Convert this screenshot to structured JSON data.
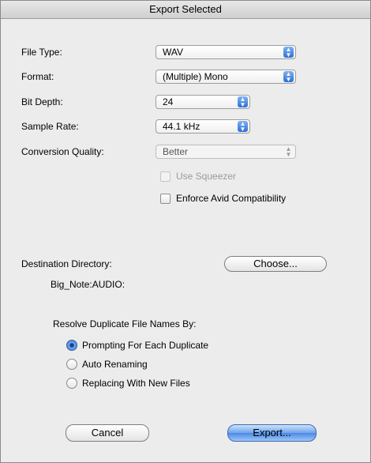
{
  "dialog": {
    "title": "Export Selected"
  },
  "fields": {
    "file_type": {
      "label": "File Type:",
      "value": "WAV"
    },
    "format": {
      "label": "Format:",
      "value": "(Multiple) Mono"
    },
    "bit_depth": {
      "label": "Bit Depth:",
      "value": "24"
    },
    "sample_rate": {
      "label": "Sample Rate:",
      "value": "44.1 kHz"
    },
    "conversion_quality": {
      "label": "Conversion Quality:",
      "value": "Better"
    }
  },
  "checkboxes": {
    "use_squeezer": {
      "label": "Use Squeezer",
      "checked": false,
      "enabled": false
    },
    "enforce_avid": {
      "label": "Enforce Avid Compatibility",
      "checked": false,
      "enabled": true
    }
  },
  "destination": {
    "label": "Destination Directory:",
    "choose_label": "Choose...",
    "path": "Big_Note:AUDIO:"
  },
  "duplicates": {
    "heading": "Resolve Duplicate File Names By:",
    "options": [
      {
        "label": "Prompting For Each Duplicate",
        "selected": true
      },
      {
        "label": "Auto Renaming",
        "selected": false
      },
      {
        "label": "Replacing With New Files",
        "selected": false
      }
    ]
  },
  "buttons": {
    "cancel": "Cancel",
    "export": "Export..."
  },
  "icons": {
    "popup_arrows": "updown-arrows-icon"
  },
  "colors": {
    "accent": "#3b7ad9",
    "background": "#ececec"
  }
}
